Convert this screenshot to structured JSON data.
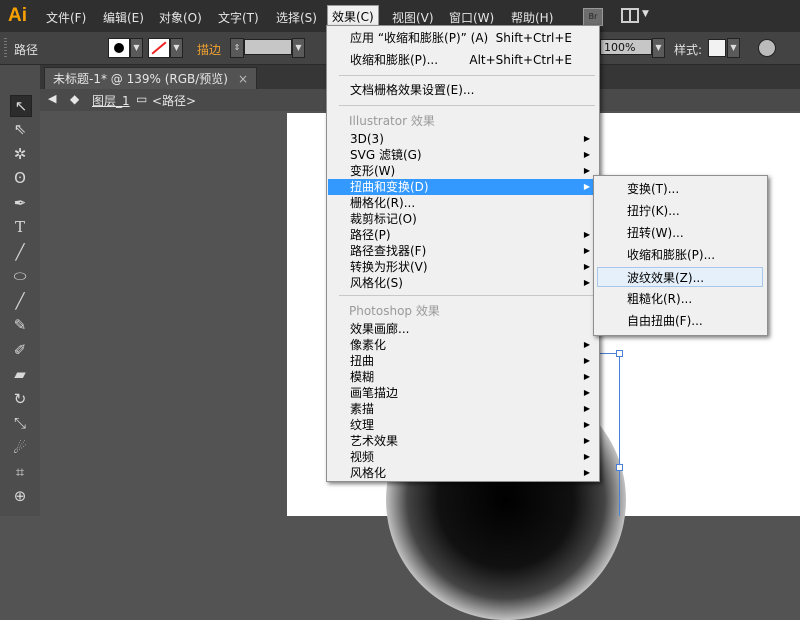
{
  "app": {
    "logo": "Ai"
  },
  "menubar": {
    "items": [
      "文件(F)",
      "编辑(E)",
      "对象(O)",
      "文字(T)",
      "选择(S)",
      "效果(C)",
      "视图(V)",
      "窗口(W)",
      "帮助(H)"
    ],
    "bridge_badge": "Br"
  },
  "control_bar": {
    "object_type": "路径",
    "stroke_label": "描边",
    "opacity": "100%",
    "style_label": "样式:"
  },
  "document": {
    "tab_title": "未标题-1* @ 139% (RGB/预览)",
    "tab_close": "×",
    "breadcrumb_layer": "图层_1",
    "breadcrumb_path": "<路径>"
  },
  "effect_menu": {
    "apply_last": "应用 “收缩和膨胀(P)” (A)",
    "apply_last_shortcut": "Shift+Ctrl+E",
    "last_effect": "收缩和膨胀(P)...",
    "last_effect_shortcut": "Alt+Shift+Ctrl+E",
    "raster_settings": "文档栅格效果设置(E)...",
    "illustrator_header": "Illustrator 效果",
    "illustrator_items": [
      "3D(3)",
      "SVG 滤镜(G)",
      "变形(W)",
      "扭曲和变换(D)",
      "栅格化(R)...",
      "裁剪标记(O)",
      "路径(P)",
      "路径查找器(F)",
      "转换为形状(V)",
      "风格化(S)"
    ],
    "photoshop_header": "Photoshop 效果",
    "photoshop_items": [
      "效果画廊...",
      "像素化",
      "扭曲",
      "模糊",
      "画笔描边",
      "素描",
      "纹理",
      "艺术效果",
      "视频",
      "风格化"
    ]
  },
  "distort_submenu": {
    "items": [
      "变换(T)...",
      "扭拧(K)...",
      "扭转(W)...",
      "收缩和膨胀(P)...",
      "波纹效果(Z)...",
      "粗糙化(R)...",
      "自由扭曲(F)..."
    ]
  },
  "icons": [
    "selection-tool-icon",
    "direct-selection-icon",
    "magic-wand-icon",
    "lasso-icon",
    "pen-icon",
    "type-icon",
    "line-icon",
    "ellipse-icon",
    "paintbrush-icon",
    "pencil-icon",
    "blob-brush-icon",
    "eraser-icon",
    "rotate-icon",
    "scale-icon",
    "warp-icon",
    "free-transform-icon",
    "shape-builder-icon"
  ],
  "colors": {
    "highlight": "#3399ff",
    "logo": "#f7a000"
  }
}
